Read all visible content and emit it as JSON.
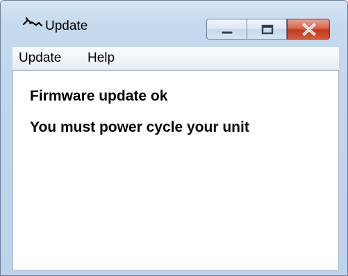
{
  "window": {
    "title": "Update",
    "icon": "network-plug-icon",
    "controls": {
      "minimize_icon": "minimize-icon",
      "maximize_icon": "maximize-icon",
      "close_icon": "close-icon",
      "close_color": "#c4391c"
    }
  },
  "menu": {
    "items": [
      {
        "label": "Update"
      },
      {
        "label": "Help"
      }
    ]
  },
  "content": {
    "lines": [
      "Firmware update ok",
      "You must power cycle your unit"
    ]
  }
}
